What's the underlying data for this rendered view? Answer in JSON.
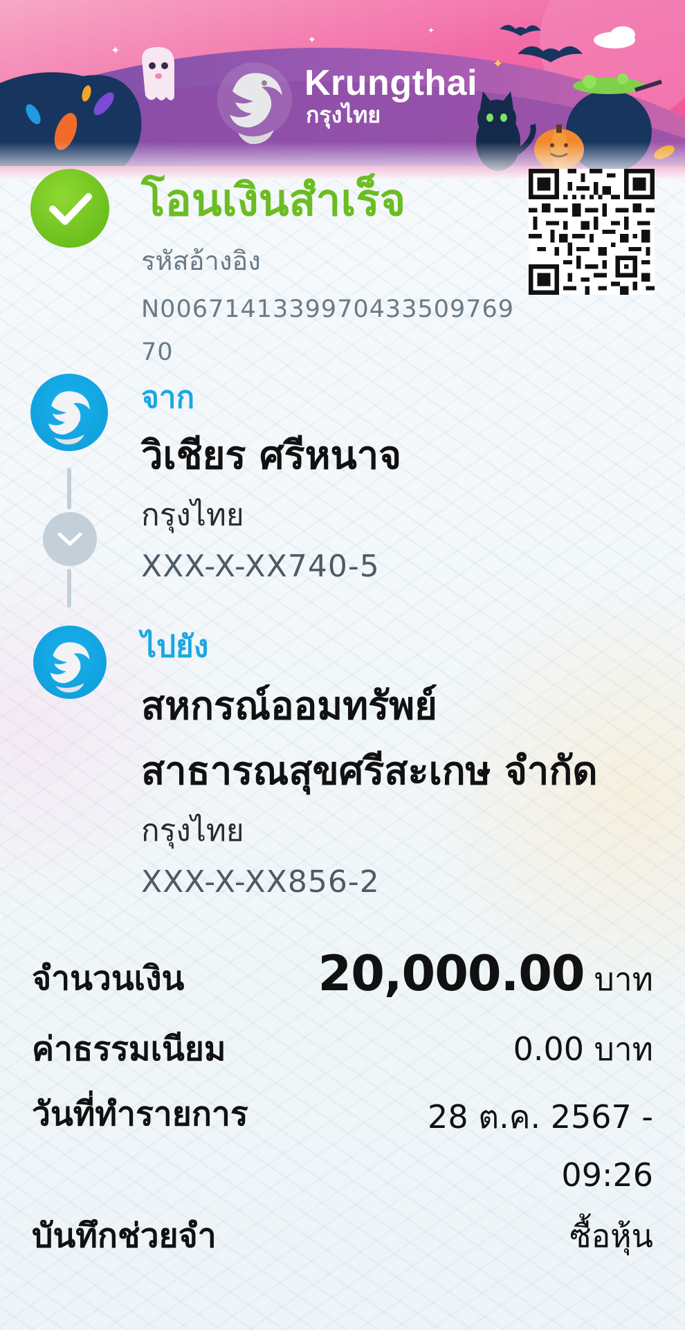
{
  "header": {
    "brand_en": "Krungthai",
    "brand_th": "กรุงไทย",
    "theme": "halloween",
    "colors": {
      "pink": "#f05aa0",
      "navy": "#16355f",
      "purple": "#8f4fb0"
    }
  },
  "status": {
    "title": "โอนเงินสำเร็จ",
    "ref_label": "รหัสอ้างอิง",
    "ref_value": "N0067141339970433509769 70"
  },
  "from": {
    "label": "จาก",
    "name": "วิเชียร ศรีหนาจ",
    "bank": "กรุงไทย",
    "account": "XXX-X-XX740-5"
  },
  "to": {
    "label": "ไปยัง",
    "name_line1": "สหกรณ์ออมทรัพย์",
    "name_line2": "สาธารณสุขศรีสะเกษ จำกัด",
    "bank": "กรุงไทย",
    "account": "XXX-X-XX856-2"
  },
  "details": {
    "amount_label": "จำนวนเงิน",
    "amount_value": "20,000.00",
    "amount_unit": "บาท",
    "fee_label": "ค่าธรรมเนียม",
    "fee_value": "0.00 บาท",
    "date_label": "วันที่ทำรายการ",
    "date_value": "28 ต.ค. 2567 - 09:26",
    "memo_label": "บันทึกช่วยจำ",
    "memo_value": "ซื้อหุ้น"
  },
  "icons": {
    "success": "check-icon",
    "bank": "krungthai-bird-logo",
    "connector": "chevron-down-icon",
    "qr": "qr-code-icon"
  },
  "colors": {
    "success_green": "#6bbd22",
    "accent_blue": "#1aa7e2",
    "connector_gray": "#c3d0d9"
  }
}
